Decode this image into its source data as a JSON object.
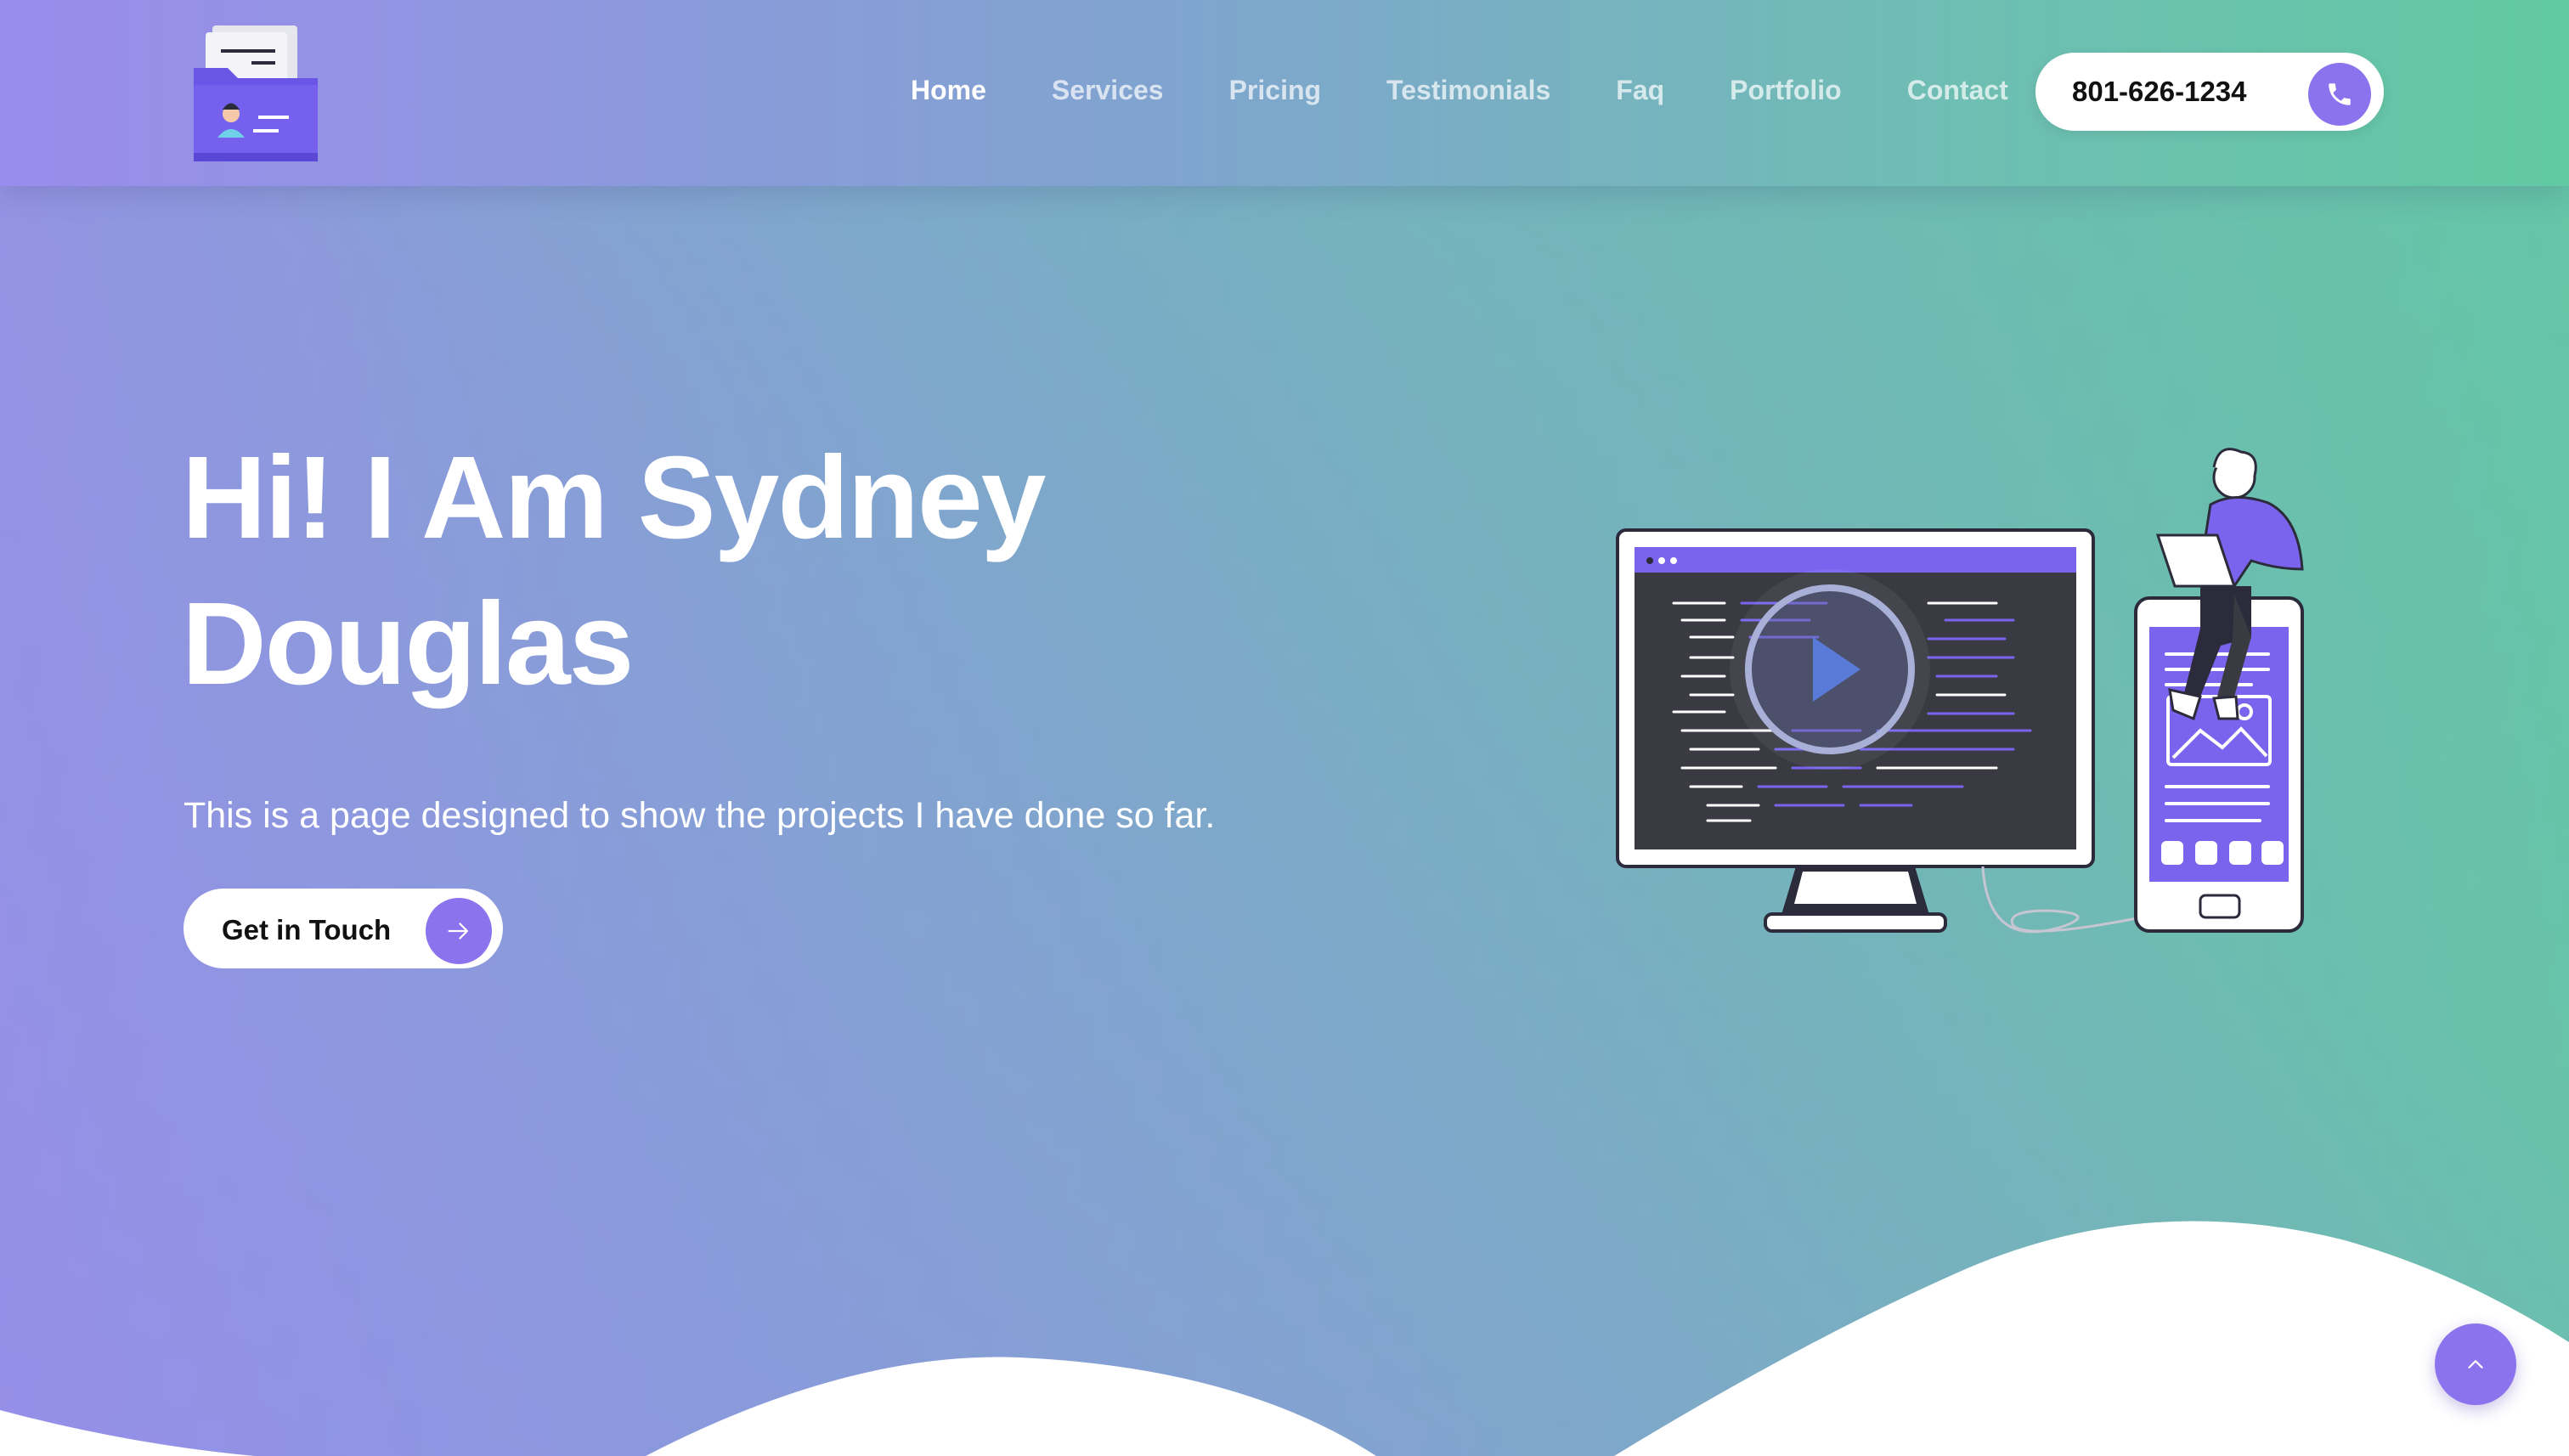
{
  "header": {
    "logo_icon": "folder-profile-icon",
    "nav": [
      {
        "label": "Home",
        "active": true
      },
      {
        "label": "Services",
        "active": false
      },
      {
        "label": "Pricing",
        "active": false
      },
      {
        "label": "Testimonials",
        "active": false
      },
      {
        "label": "Faq",
        "active": false
      },
      {
        "label": "Portfolio",
        "active": false
      },
      {
        "label": "Contact",
        "active": false
      }
    ],
    "phone": {
      "number": "801-626-1234",
      "icon": "phone-icon"
    }
  },
  "hero": {
    "title_line1": "Hi! I Am Sydney",
    "title_line2": "Douglas",
    "subtitle": "This is a page designed to show the projects I have done so far.",
    "cta_label": "Get in Touch",
    "cta_icon": "arrow-right-icon",
    "illustration": "developer-monitor-phone-illustration"
  },
  "scroll_top_icon": "chevron-up-icon",
  "colors": {
    "accent": "#8a73ec",
    "gradient_start": "#9a8cec",
    "gradient_end": "#62c9a2",
    "text_light": "#ffffff"
  }
}
